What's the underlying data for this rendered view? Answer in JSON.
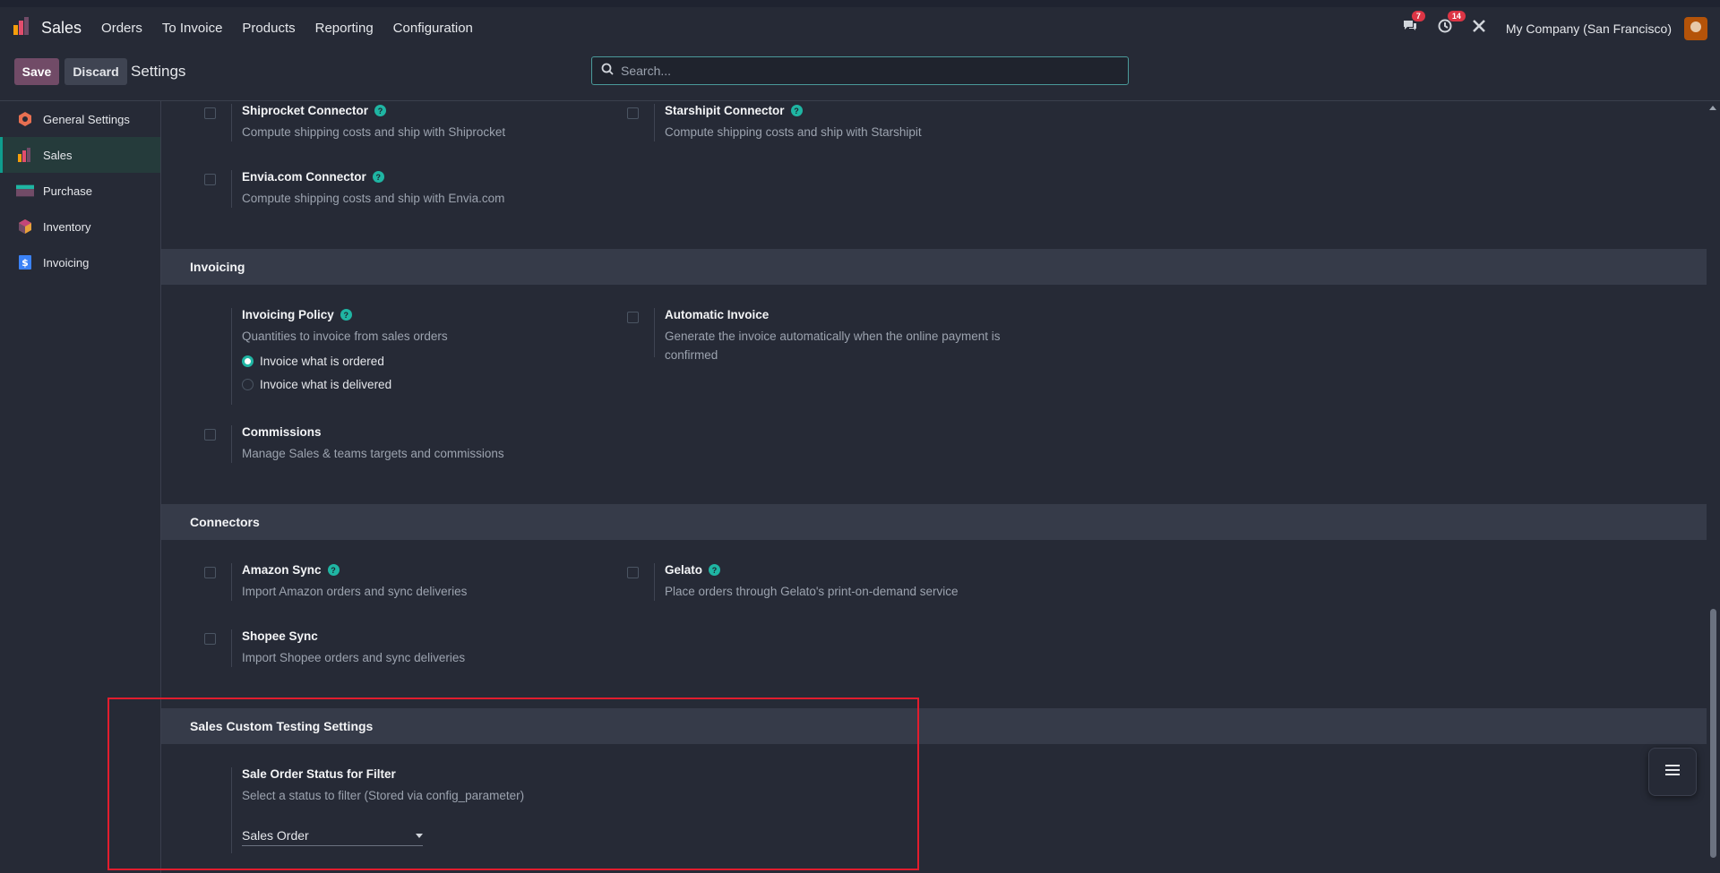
{
  "navbar": {
    "app_name": "Sales",
    "menu": [
      "Orders",
      "To Invoice",
      "Products",
      "Reporting",
      "Configuration"
    ],
    "messages_count": "7",
    "activities_count": "14",
    "company": "My Company (San Francisco)"
  },
  "control_panel": {
    "save_label": "Save",
    "discard_label": "Discard",
    "breadcrumb": "Settings",
    "search_placeholder": "Search..."
  },
  "sidebar": {
    "items": [
      {
        "label": "General Settings",
        "icon": "general-settings-icon"
      },
      {
        "label": "Sales",
        "icon": "sales-icon",
        "active": true
      },
      {
        "label": "Purchase",
        "icon": "purchase-icon"
      },
      {
        "label": "Inventory",
        "icon": "inventory-icon"
      },
      {
        "label": "Invoicing",
        "icon": "invoicing-icon"
      }
    ]
  },
  "shipping": {
    "shiprocket": {
      "title": "Shiprocket Connector",
      "desc": "Compute shipping costs and ship with Shiprocket"
    },
    "starshipit": {
      "title": "Starshipit Connector",
      "desc": "Compute shipping costs and ship with Starshipit"
    },
    "envia": {
      "title": "Envia.com Connector",
      "desc": "Compute shipping costs and ship with Envia.com"
    }
  },
  "invoicing": {
    "heading": "Invoicing",
    "policy": {
      "title": "Invoicing Policy",
      "desc": "Quantities to invoice from sales orders",
      "options": [
        "Invoice what is ordered",
        "Invoice what is delivered"
      ],
      "selected": 0
    },
    "auto_invoice": {
      "title": "Automatic Invoice",
      "desc_line1": "Generate the invoice automatically when the online payment is",
      "desc_line2": "confirmed"
    },
    "commissions": {
      "title": "Commissions",
      "desc": "Manage Sales & teams targets and commissions"
    }
  },
  "connectors": {
    "heading": "Connectors",
    "amazon": {
      "title": "Amazon Sync",
      "desc": "Import Amazon orders and sync deliveries"
    },
    "gelato": {
      "title": "Gelato",
      "desc": "Place orders through Gelato's print-on-demand service"
    },
    "shopee": {
      "title": "Shopee Sync",
      "desc": "Import Shopee orders and sync deliveries"
    }
  },
  "custom": {
    "heading": "Sales Custom Testing Settings",
    "status_filter": {
      "title": "Sale Order Status for Filter",
      "desc": "Select a status to filter (Stored via config_parameter)",
      "value": "Sales Order"
    }
  },
  "colors": {
    "accent": "#714b67",
    "teal": "#1fb5a3",
    "highlight": "#e11d2e"
  }
}
